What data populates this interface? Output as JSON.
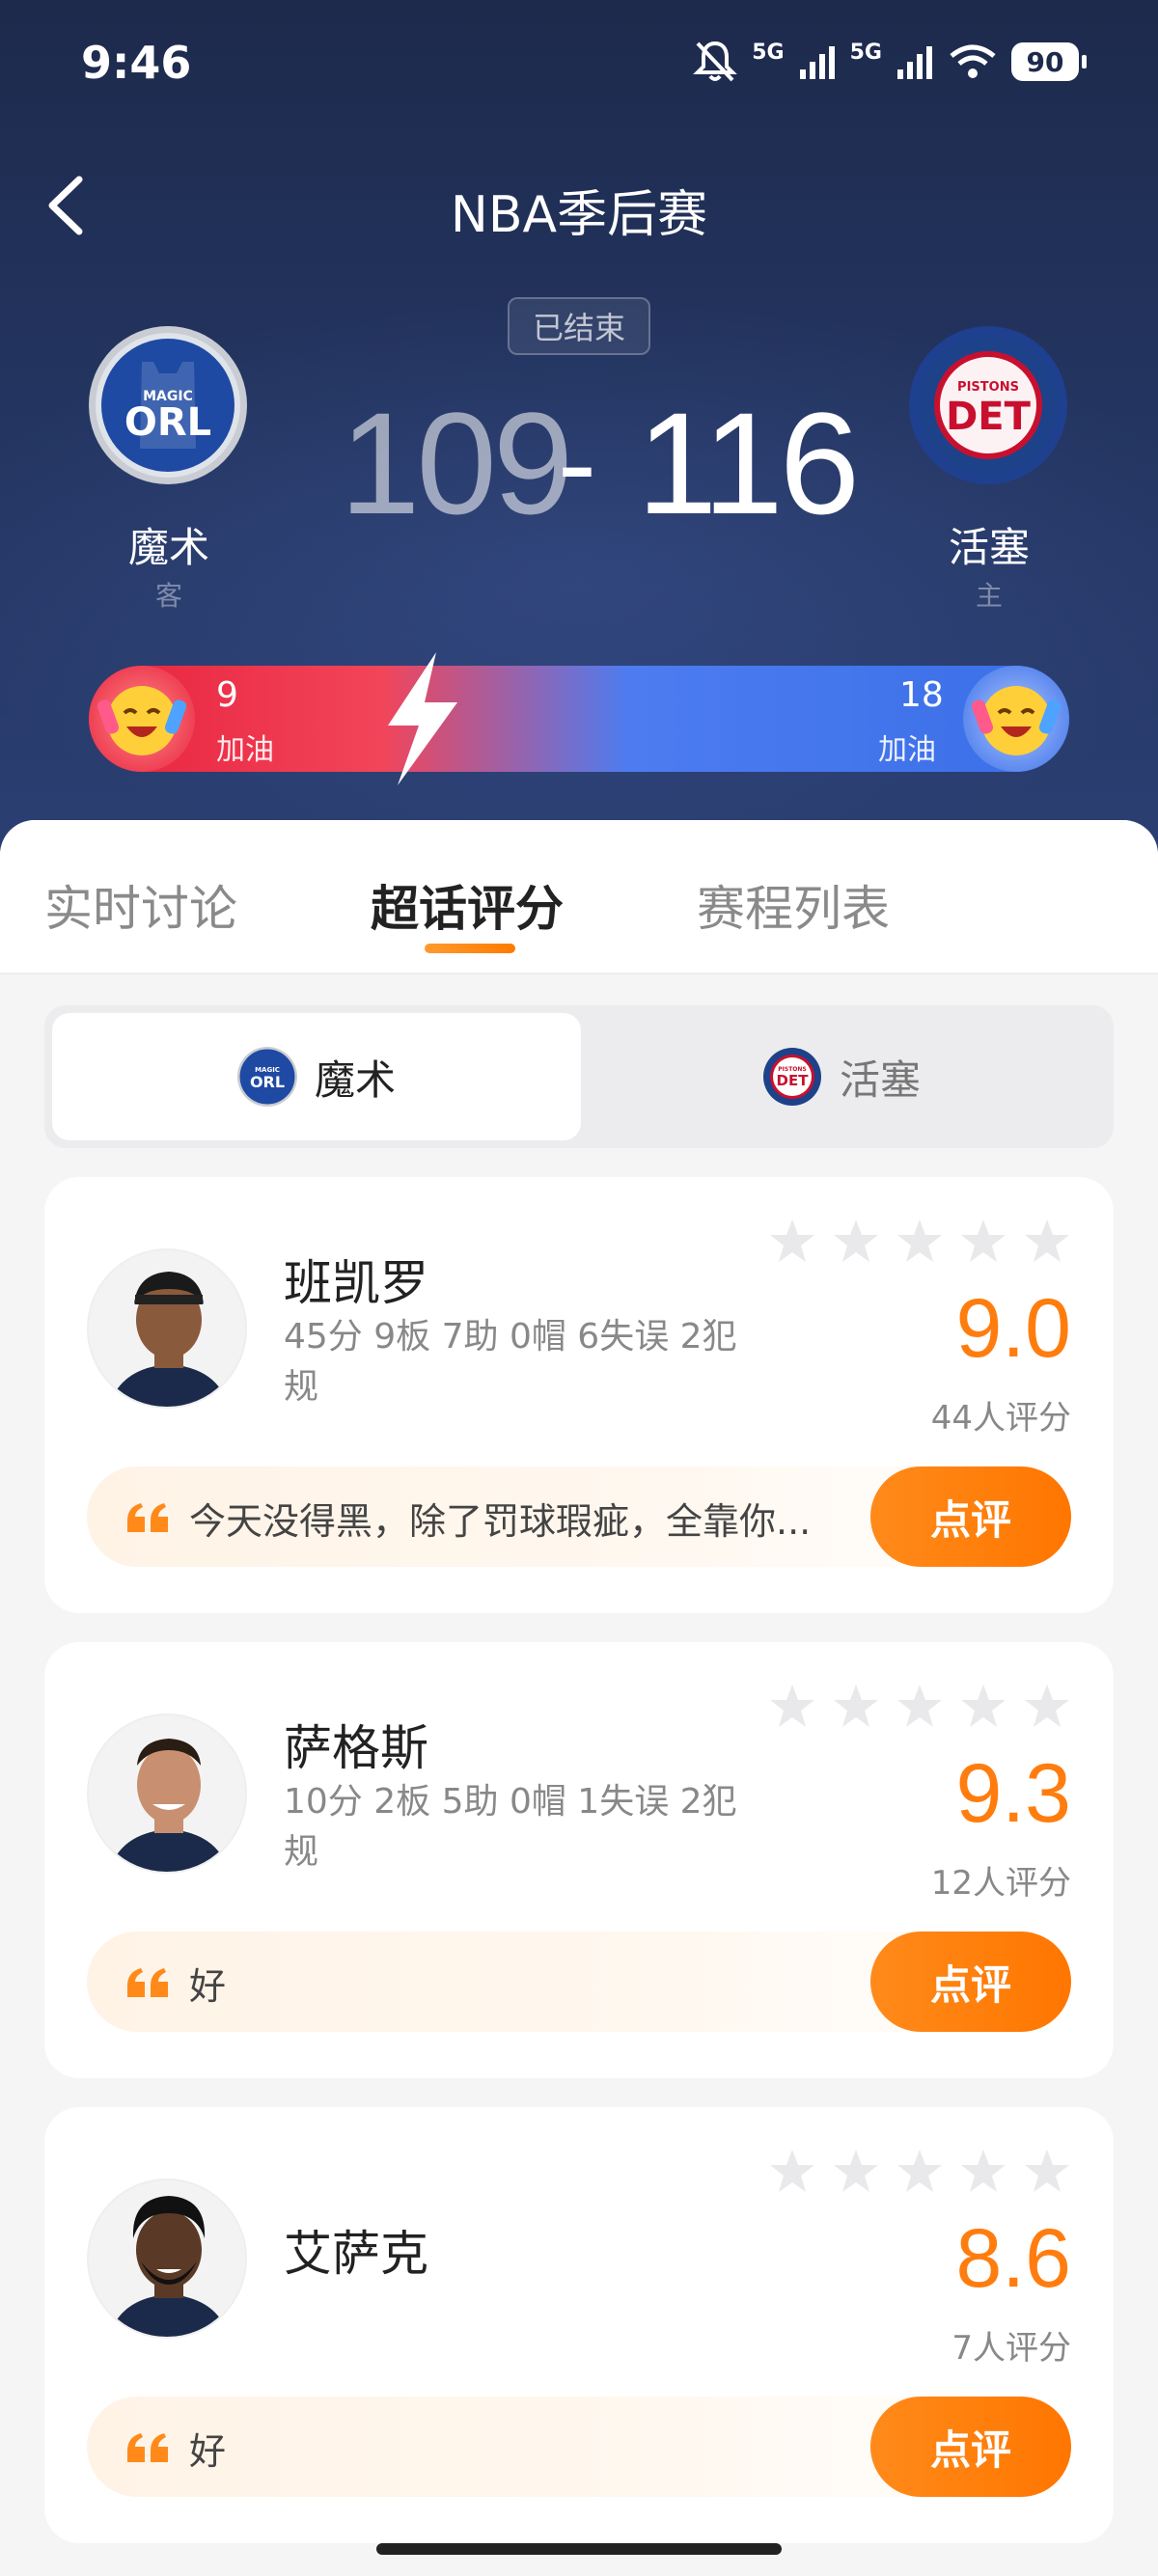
{
  "status_bar": {
    "time": "9:46",
    "network1": "5G",
    "network2": "5G",
    "battery": "90"
  },
  "header": {
    "title": "NBA季后赛",
    "game_status": "已结束"
  },
  "away_team": {
    "name": "魔术",
    "side": "客",
    "abbr": "ORL",
    "logo_top_text": "MAGIC",
    "score": "109",
    "support_count": "9",
    "support_label": "加油",
    "color": "#1f4aa3"
  },
  "home_team": {
    "name": "活塞",
    "side": "主",
    "abbr": "DET",
    "logo_top_text": "PISTONS",
    "score": "116",
    "support_count": "18",
    "support_label": "加油",
    "color": "#c8102e"
  },
  "score_separator": "-",
  "tabs": [
    {
      "label": "实时讨论",
      "active": false
    },
    {
      "label": "超话评分",
      "active": true
    },
    {
      "label": "赛程列表",
      "active": false
    }
  ],
  "team_switch": [
    {
      "label": "魔术",
      "active": true
    },
    {
      "label": "活塞",
      "active": false
    }
  ],
  "players": [
    {
      "name": "班凯罗",
      "stats": "45分 9板 7助 0帽 6失误 2犯规",
      "rating": "9.0",
      "rating_count": "44人评分",
      "comment": "今天没得黑，除了罚球瑕疵，全靠你...",
      "review_label": "点评"
    },
    {
      "name": "萨格斯",
      "stats": "10分 2板 5助 0帽 1失误 2犯规",
      "rating": "9.3",
      "rating_count": "12人评分",
      "comment": "好",
      "review_label": "点评"
    },
    {
      "name": "艾萨克",
      "stats": "",
      "rating": "8.6",
      "rating_count": "7人评分",
      "comment": "好",
      "review_label": "点评"
    }
  ],
  "colors": {
    "accent": "#ff7d0f",
    "header_bg": "#1d2a4c",
    "support_red": "#e8223d",
    "support_blue": "#3a6fe8"
  }
}
